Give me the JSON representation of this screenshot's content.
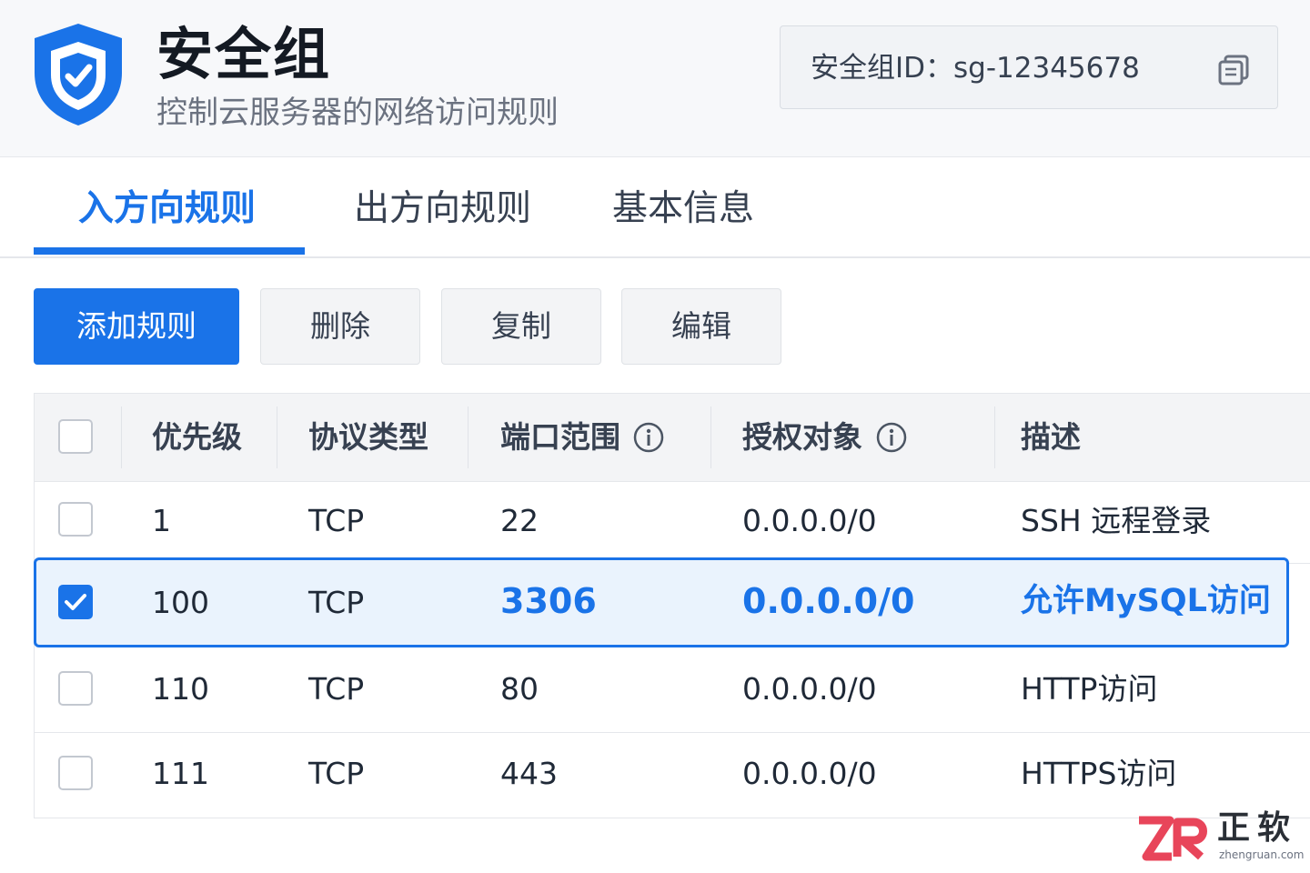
{
  "header": {
    "title": "安全组",
    "subtitle": "控制云服务器的网络访问规则",
    "id_text": "安全组ID：sg-12345678",
    "icons": {
      "logo": "shield-check-icon",
      "copy": "copy-icon"
    }
  },
  "tabs": [
    {
      "label": "入方向规则",
      "active": true
    },
    {
      "label": "出方向规则",
      "active": false
    },
    {
      "label": "基本信息",
      "active": false
    }
  ],
  "toolbar": {
    "add_label": "添加规则",
    "delete_label": "删除",
    "copy_label": "复制",
    "edit_label": "编辑"
  },
  "table": {
    "columns": [
      "优先级",
      "协议类型",
      "端口范围",
      "授权对象",
      "描述"
    ],
    "rows": [
      {
        "priority": "1",
        "protocol": "TCP",
        "port": "22",
        "source": "0.0.0.0/0",
        "description": "SSH 远程登录",
        "checked": false
      },
      {
        "priority": "100",
        "protocol": "TCP",
        "port": "3306",
        "source": "0.0.0.0/0",
        "description": "允许MySQL访问",
        "checked": true
      },
      {
        "priority": "110",
        "protocol": "TCP",
        "port": "80",
        "source": "0.0.0.0/0",
        "description": "HTTP访问",
        "checked": false
      },
      {
        "priority": "111",
        "protocol": "TCP",
        "port": "443",
        "source": "0.0.0.0/0",
        "description": "HTTPS访问",
        "checked": false
      }
    ]
  },
  "watermark": {
    "name": "正软",
    "domain": "zhengruan.com"
  },
  "colors": {
    "accent": "#1a73e8",
    "selected_row_bg": "#eaf3fd",
    "header_bg": "#f7f8fa"
  }
}
